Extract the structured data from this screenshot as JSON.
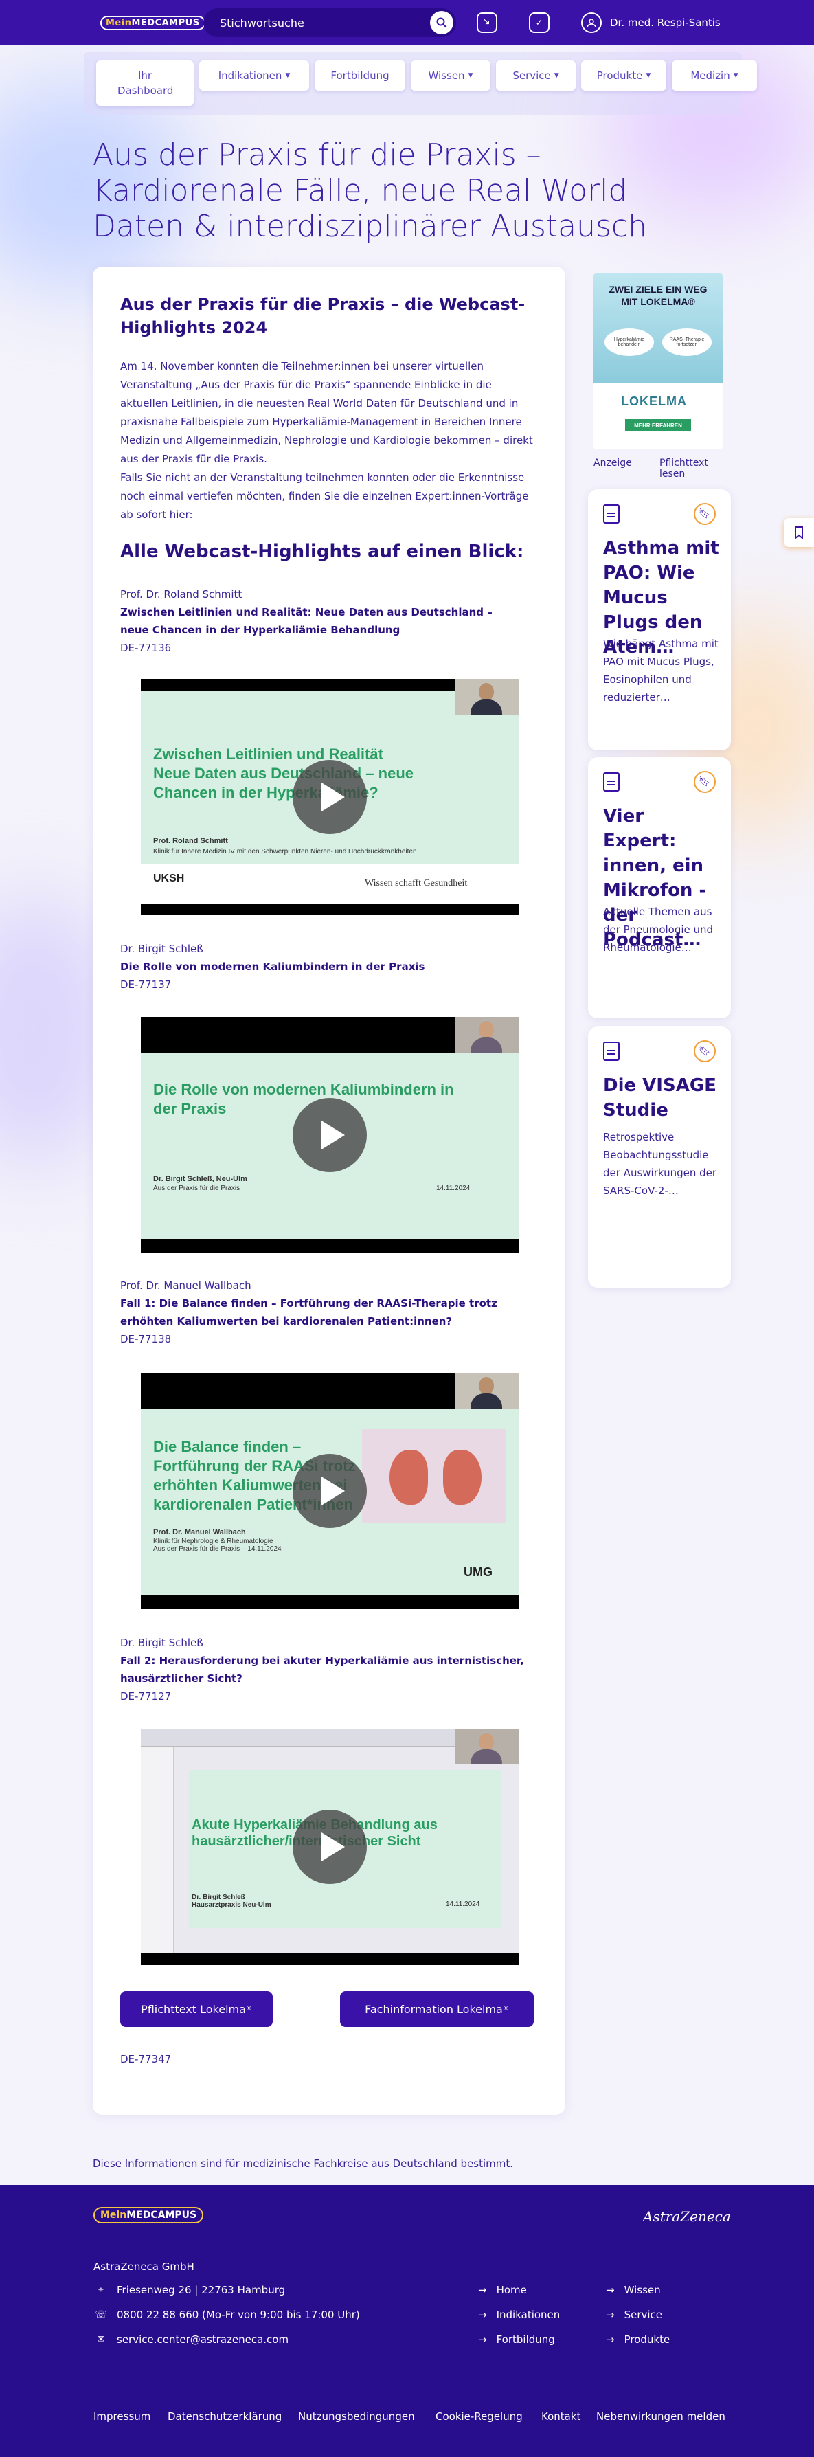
{
  "header": {
    "logo_mein": "Mein",
    "logo_rest": "MEDCAMPUS",
    "search_placeholder": "Stichwortsuche",
    "user_name": "Dr. med. Respi-Santis"
  },
  "nav": {
    "tabs": [
      {
        "label": "Ihr Dashboard",
        "active": true
      },
      {
        "label": "Indikationen",
        "dropdown": true
      },
      {
        "label": "Fortbildung",
        "dropdown": false
      },
      {
        "label": "Wissen",
        "dropdown": true
      },
      {
        "label": "Service",
        "dropdown": true
      },
      {
        "label": "Produkte",
        "dropdown": true
      },
      {
        "label": "Medizin",
        "dropdown": true
      }
    ]
  },
  "page": {
    "title": "Aus der Praxis für die Praxis – Kardiorenale Fälle, neue Real World Daten & interdisziplinärer Austausch"
  },
  "article": {
    "heading": "Aus der Praxis für die Praxis – die Webcast-Highlights 2024",
    "intro": "Am 14. November konnten die Teilnehmer:innen bei unserer virtuellen Veranstaltung „Aus der Praxis für die Praxis“ spannende Einblicke in die aktuellen Leitlinien, in die neuesten Real World Daten für Deutschland und in praxisnahe Fallbeispiele zum Hyperkaliämie-Management in Bereichen Innere Medizin und Allgemeinmedizin, Nephrologie und Kardiologie bekommen – direkt aus der Praxis für die Praxis.",
    "intro2": "Falls Sie nicht an der Veranstaltung teilnehmen konnten oder die Erkenntnisse noch einmal vertiefen möchten, finden Sie die einzelnen Expert:innen-Vorträge ab sofort hier:",
    "subheading": "Alle Webcast-Highlights auf einen Blick:",
    "talks": [
      {
        "speaker": "Prof. Dr. Roland Schmitt",
        "title": "Zwischen Leitlinien und Realität: Neue Daten aus Deutschland – neue Chancen in der Hyperkaliämie Behandlung",
        "code": "DE-77136",
        "slide_title": "Zwischen Leitlinien und Realität\nNeue Daten aus Deutschland – neue Chancen in der Hyperkaliämie?",
        "slide_name": "Prof. Roland Schmitt",
        "slide_inst": "Klinik für Innere Medizin IV mit den Schwerpunkten Nieren- und Hochdruckkrankheiten",
        "slide_footer": "Wissen schafft Gesundheit",
        "slide_logo": "UKSH"
      },
      {
        "speaker": "Dr. Birgit Schleß",
        "title": "Die Rolle von modernen Kaliumbindern in der Praxis",
        "code": "DE-77137",
        "slide_title": "Die Rolle von modernen Kaliumbindern in der Praxis",
        "slide_name": "Dr. Birgit Schleß, Neu-Ulm",
        "slide_inst": "Aus der Praxis für die Praxis",
        "slide_date": "14.11.2024"
      },
      {
        "speaker": "Prof. Dr. Manuel Wallbach",
        "title": "Fall 1: Die Balance finden – Fortführung der RAASi-Therapie trotz erhöhten Kaliumwerten bei kardiorenalen Patient:innen?",
        "code": "DE-77138",
        "slide_title": "Die Balance finden – Fortführung der RAASi trotz erhöhten Kaliumwerten bei kardiorenalen Patient*innen",
        "slide_name": "Prof. Dr. Manuel Wallbach",
        "slide_inst": "Klinik für Nephrologie & Rheumatologie\nAus der Praxis für die Praxis – 14.11.2024",
        "slide_logo": "UMG"
      },
      {
        "speaker": "Dr. Birgit Schleß",
        "title": "Fall 2: Herausforderung bei akuter Hyperkaliämie aus internistischer, hausärztlicher Sicht?",
        "code": "DE-77127",
        "slide_title": "Akute Hyperkaliämie Behandlung aus hausärztlicher/internistischer Sicht",
        "slide_name": "Dr. Birgit Schleß\nHausarztpraxis Neu-Ulm",
        "slide_date": "14.11.2024"
      }
    ],
    "btn_pflichttext": "Pflichttext Lokelma",
    "btn_fachinfo": "Fachinformation Lokelma",
    "footer_code": "DE-77347"
  },
  "ad": {
    "headline": "ZWEI ZIELE EIN WEG MIT LOKELMA®",
    "bubble1": "Hyperkaliämie behandeln",
    "bubble2": "RAASi-Therapie fortsetzen",
    "brand": "LOKELMA",
    "cta": "MEHR ERFAHREN",
    "label_anzeige": "Anzeige",
    "label_pflicht": "Pflichttext lesen"
  },
  "sidebar": {
    "cards": [
      {
        "title": "Asthma mit PAO: Wie Mucus Plugs den Atem…",
        "desc": "Wie hängt Asthma mit PAO mit Mucus Plugs, Eosinophilen und reduzierter…"
      },
      {
        "title": "Vier Expert: innen, ein Mikrofon - der Podcast…",
        "desc": "Aktuelle Themen aus der Pneumologie und Rheumatologie…"
      },
      {
        "title": "Die VISAGE Studie",
        "desc": "Retrospektive Beobachtungsstudie der Auswirkungen der SARS-CoV-2-…"
      }
    ]
  },
  "disclaimer": "Diese Informationen sind für medizinische Fachkreise aus Deutschland bestimmt.",
  "footer": {
    "logo_mein": "Mein",
    "logo_rest": "MEDCAMPUS",
    "brand": "AstraZeneca",
    "company": "AstraZeneca GmbH",
    "address": "Friesenweg 26 | 22763 Hamburg",
    "phone": "0800 22 88 660 (Mo-Fr von 9:00 bis 17:00 Uhr)",
    "email": "service.center@astrazeneca.com",
    "links_col1": [
      "Home",
      "Indikationen",
      "Fortbildung"
    ],
    "links_col2": [
      "Wissen",
      "Service",
      "Produkte"
    ],
    "legal": [
      "Impressum",
      "Datenschutzerklärung",
      "Nutzungsbedingungen",
      "Cookie-Regelung",
      "Kontakt",
      "Nebenwirkungen melden"
    ]
  },
  "colors": {
    "primary": "#3a12a8",
    "footer": "#280e8c",
    "accent": "#f2a13a",
    "slide_green": "#2a9e62"
  }
}
